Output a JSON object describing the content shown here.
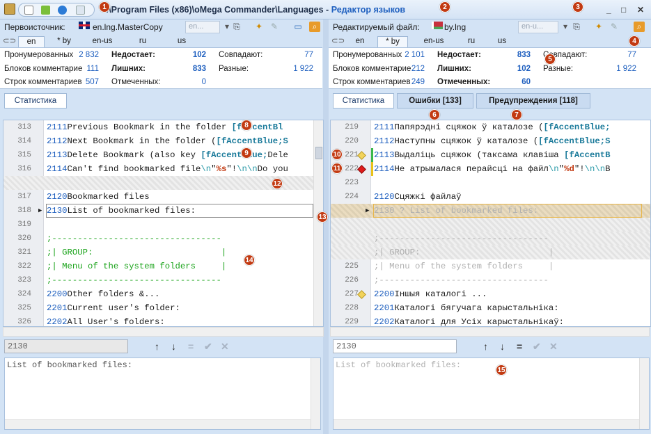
{
  "window": {
    "path_prefix": ":\\Program Files (x86)\\oMega Commander\\Languages",
    "separator": " - ",
    "app_title": "Редактор языков",
    "controls": [
      "_",
      "□",
      "✕"
    ]
  },
  "left": {
    "source_label": "Первоисточник:",
    "file_name": "en.lng.MasterCopy",
    "combo_value": "en...",
    "lang_tabs": [
      "en",
      "* by",
      "en-us",
      "ru",
      "us"
    ],
    "active_tab": 0,
    "stats": {
      "numbered_label": "Пронумерованных",
      "numbered_value": "2 832",
      "comment_blocks_label": "Блоков комментарие",
      "comment_blocks_value": "111",
      "comment_lines_label": "Строк комментариев",
      "comment_lines_value": "507",
      "missing_label": "Недостает:",
      "missing_value": "102",
      "extra_label": "Лишних:",
      "extra_value": "833",
      "marked_label": "Отмеченных:",
      "marked_value": "0",
      "match_label": "Совпадают:",
      "match_value": "77",
      "diff_label": "Разные:",
      "diff_value": "1 922"
    },
    "subtabs": [
      "Статистика"
    ],
    "lines": [
      {
        "n": "313",
        "id": "2111",
        "text": "Previous Bookmark in the folder ",
        "kw": "[fAccentBl"
      },
      {
        "n": "314",
        "id": "2112",
        "text": "Next Bookmark in the folder (",
        "kw": "[fAccentBlue;S"
      },
      {
        "n": "315",
        "id": "2113",
        "text": "Delete Bookmark (also key ",
        "kw": "[fAccentBlue;",
        "tail": "Dele"
      },
      {
        "n": "316",
        "id": "2114",
        "text": "Can't find bookmarked file",
        "esc1": "\\n",
        "mid": "\"",
        "fmt": "%s",
        "mid2": "\"!",
        "esc2": "\\n\\n",
        "tail": "Do you"
      },
      {
        "n": "317",
        "id": "2120",
        "text": "Bookmarked files"
      },
      {
        "n": "318",
        "id": "2130",
        "text": "List of bookmarked files:"
      },
      {
        "n": "319",
        "text": ""
      },
      {
        "n": "320",
        "comment": ";---------------------------------"
      },
      {
        "n": "321",
        "comment": ";| GROUP:                         |"
      },
      {
        "n": "322",
        "comment": ";| Menu of the system folders     |"
      },
      {
        "n": "323",
        "comment": ";---------------------------------"
      },
      {
        "n": "324",
        "id": "2200",
        "text": "Other folders &..."
      },
      {
        "n": "325",
        "id": "2201",
        "text": "Current user's folder:"
      },
      {
        "n": "326",
        "id": "2202",
        "text": "All User's folders:"
      }
    ],
    "edit_id": "2130",
    "edit_text": "List of bookmarked files:",
    "nav": [
      "↑",
      "↓",
      "=",
      "✔",
      "✕"
    ]
  },
  "right": {
    "edited_label": "Редактируемый файл:",
    "file_name": "by.lng",
    "combo_value": "en-u...",
    "lang_tabs": [
      "en",
      "* by",
      "en-us",
      "ru",
      "us"
    ],
    "active_tab": 1,
    "stats": {
      "numbered_label": "Пронумерованных",
      "numbered_value": "2 101",
      "comment_blocks_label": "Блоков комментарие",
      "comment_blocks_value": "212",
      "comment_lines_label": "Строк комментариев",
      "comment_lines_value": "249",
      "missing_label": "Недостает:",
      "missing_value": "833",
      "extra_label": "Лишних:",
      "extra_value": "102",
      "marked_label": "Отмеченных:",
      "marked_value": "60",
      "match_label": "Совпадают:",
      "match_value": "77",
      "diff_label": "Разные:",
      "diff_value": "1 922"
    },
    "subtabs": [
      "Статистика",
      "Ошибки [133]",
      "Предупреждения [118]"
    ],
    "lines": [
      {
        "n": "219",
        "id": "2111",
        "text": "Папярэдні сцяжок ў каталозе (",
        "kw": "[fAccentBlue;"
      },
      {
        "n": "220",
        "id": "2112",
        "text": "Наступны сцяжок ў каталозе (",
        "kw": "[fAccentBlue;S"
      },
      {
        "n": "221",
        "id": "2113",
        "text": "Выдаліць сцяжок (таксама клавіша ",
        "kw": "[fAccentB"
      },
      {
        "n": "222",
        "id": "2114",
        "text": "Не атрымалася перайсці на файл",
        "esc1": "\\n",
        "mid": "\"",
        "fmt": "%d",
        "mid2": "\"!",
        "esc2": "\\n\\n",
        "tail": "В"
      },
      {
        "n": "223",
        "text": ""
      },
      {
        "n": "224",
        "id": "2120",
        "text": "Сцяжкі файлаў"
      },
      {
        "n": "",
        "ghost": "2130 ? List of bookmarked files:"
      },
      {
        "n": "",
        "ghost": ""
      },
      {
        "n": "",
        "ghost": ";---------------------------------"
      },
      {
        "n": "",
        "ghost": ";| GROUP:                         |"
      },
      {
        "n": "225",
        "ghost": ";| Menu of the system folders     |"
      },
      {
        "n": "226",
        "comment": ";---------------------------------"
      },
      {
        "n": "227",
        "id": "2200",
        "text": "Іншыя каталогі ..."
      },
      {
        "n": "228",
        "id": "2201",
        "text": "Каталогі бягучага карыстальніка:"
      },
      {
        "n": "229",
        "id": "2202",
        "text": "Каталогі для Усіх карыстальнікаў:"
      }
    ],
    "edit_id": "2130",
    "edit_text": "List of bookmarked files:",
    "nav": [
      "↑",
      "↓",
      "=",
      "✔",
      "✕"
    ]
  },
  "callouts": [
    "1",
    "2",
    "3",
    "4",
    "5",
    "6",
    "7",
    "8",
    "9",
    "10",
    "11",
    "12",
    "13",
    "14",
    "15"
  ],
  "colors": {
    "accent": "#1e5fbf",
    "callout": "#c23a12",
    "comment": "#1aa31a"
  }
}
